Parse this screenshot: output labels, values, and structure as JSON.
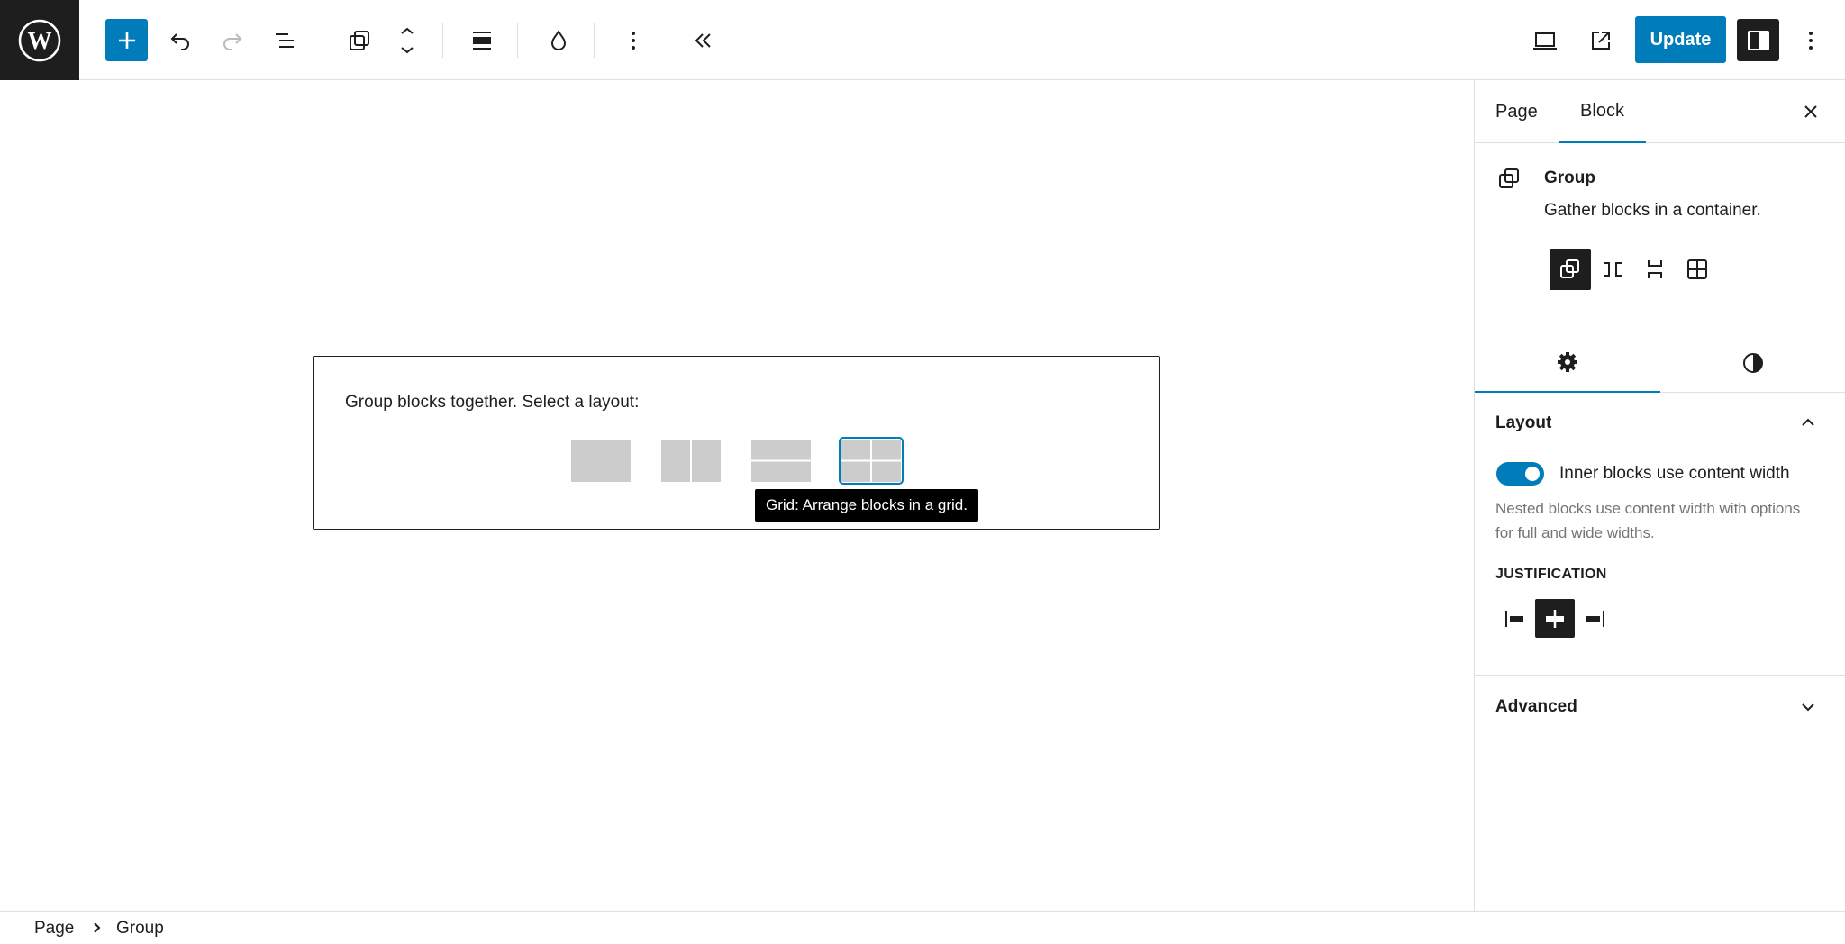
{
  "header": {
    "logo_icon": "wordpress-logo-icon",
    "toolbar": [
      {
        "name": "block-inserter-button",
        "icon": "plus-icon"
      },
      {
        "name": "undo-button",
        "icon": "undo-icon"
      },
      {
        "name": "redo-button",
        "icon": "redo-icon"
      },
      {
        "name": "document-overview-button",
        "icon": "list-view-icon"
      },
      {
        "name": "block-type-button",
        "icon": "group-block-icon"
      },
      {
        "name": "move-block-button",
        "icon": "chevron-up-down-icon"
      },
      {
        "name": "align-button",
        "icon": "align-none-icon"
      },
      {
        "name": "color-button",
        "icon": "drop-icon"
      },
      {
        "name": "block-options-button",
        "icon": "more-vertical-icon"
      },
      {
        "name": "collapse-toolbar-button",
        "icon": "double-chevron-left-icon"
      }
    ],
    "preview_icon": "desktop-icon",
    "view_page_icon": "external-link-icon",
    "update_label": "Update",
    "settings_icon": "sidebar-icon",
    "options_icon": "more-vertical-icon"
  },
  "placeholder": {
    "label": "Group blocks together. Select a layout:",
    "variations": [
      "Group",
      "Row",
      "Stack",
      "Grid"
    ],
    "selected_variation": "Grid",
    "tooltip": "Grid: Arrange blocks in a grid."
  },
  "sidebar": {
    "tabs": [
      "Page",
      "Block"
    ],
    "active_tab": "Block",
    "block": {
      "title": "Group",
      "description": "Gather blocks in a container."
    },
    "style_tabs": [
      "settings-gear-icon",
      "styles-contrast-icon"
    ],
    "layout_panel": {
      "title": "Layout",
      "toggle_label": "Inner blocks use content width",
      "toggle_on": true,
      "help": "Nested blocks use content width with options for full and wide widths.",
      "justification_label": "JUSTIFICATION",
      "justification_active": "center"
    },
    "advanced_panel": {
      "title": "Advanced"
    }
  },
  "breadcrumbs": [
    "Page",
    "Group"
  ],
  "colors": {
    "accent": "#007cba",
    "dark": "#1e1e1e",
    "variation_fill": "#cccccc"
  }
}
